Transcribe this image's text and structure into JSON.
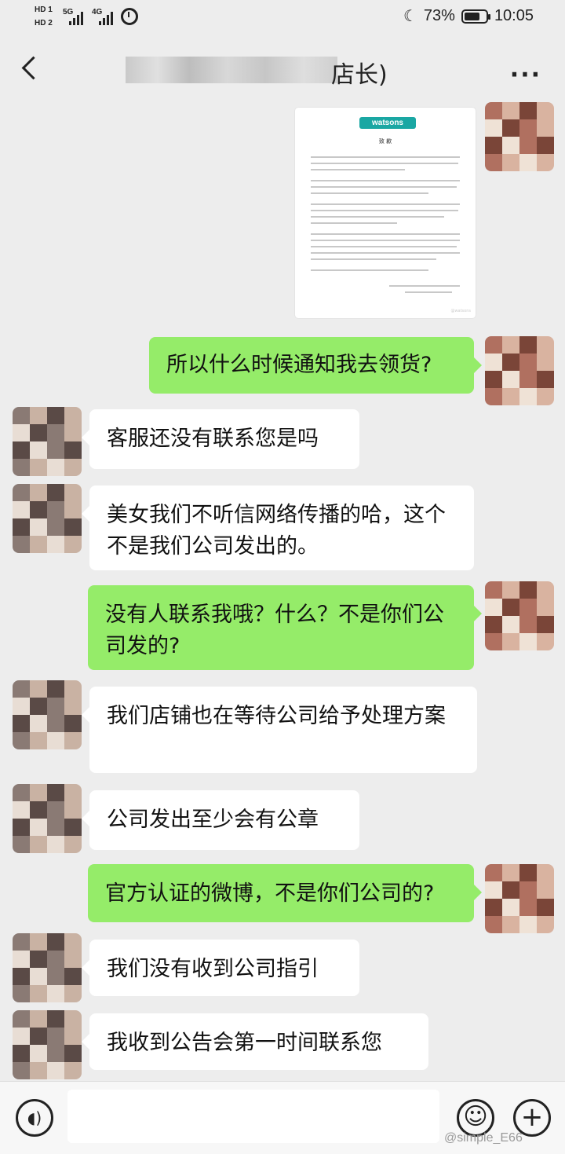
{
  "status_bar": {
    "sim1": "HD 1",
    "sim2": "HD 2",
    "net1": "5G",
    "net2": "4G",
    "battery_pct": "73%",
    "battery_level": 0.73,
    "time": "10:05"
  },
  "chat": {
    "title_visible": "店长)",
    "more_label": "···"
  },
  "image_message": {
    "logo_text": "watsons",
    "doc_heading": "致 歉",
    "watermark": "@watsons"
  },
  "messages": [
    {
      "sender": "me",
      "text": "所以什么时候通知我去领货?"
    },
    {
      "sender": "other",
      "text": "客服还没有联系您是吗"
    },
    {
      "sender": "other",
      "text": "美女我们不听信网络传播的哈，这个不是我们公司发出的。"
    },
    {
      "sender": "me",
      "text": "没有人联系我哦？什么？不是你们公司发的?"
    },
    {
      "sender": "other",
      "text": "我们店铺也在等待公司给予处理方案"
    },
    {
      "sender": "other",
      "text": "公司发出至少会有公章"
    },
    {
      "sender": "me",
      "text": "官方认证的微博，不是你们公司的?"
    },
    {
      "sender": "other",
      "text": "我们没有收到公司指引"
    },
    {
      "sender": "other",
      "text": "我收到公告会第一时间联系您"
    }
  ],
  "input_bar": {
    "voice_icon": "voice-icon",
    "emoji_icon": "emoji-icon",
    "plus_icon": "plus-icon",
    "voice_glyph": "◖)",
    "emoji_glyph": "☺",
    "plus_glyph": "+"
  },
  "watermark": "@simple_E66",
  "colors": {
    "bg": "#ededed",
    "me_bubble": "#95ec69",
    "other_bubble": "#ffffff",
    "brand": "#1aa7a3"
  }
}
